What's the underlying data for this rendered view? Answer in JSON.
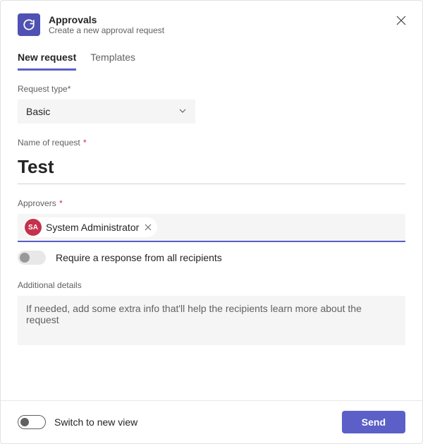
{
  "header": {
    "title": "Approvals",
    "subtitle": "Create a new approval request"
  },
  "tabs": {
    "new_request": "New request",
    "templates": "Templates"
  },
  "fields": {
    "request_type_label": "Request type*",
    "request_type_value": "Basic",
    "name_label": "Name of request ",
    "name_value": "Test",
    "approvers_label": "Approvers ",
    "approver_initials": "SA",
    "approver_name": "System Administrator",
    "require_response_label": "Require a response from all recipients",
    "additional_label": "Additional details",
    "additional_placeholder": "If needed, add some extra info that'll help the recipients learn more about the request"
  },
  "footer": {
    "switch_label": "Switch to new view",
    "send_label": "Send"
  },
  "required_marker": "*"
}
